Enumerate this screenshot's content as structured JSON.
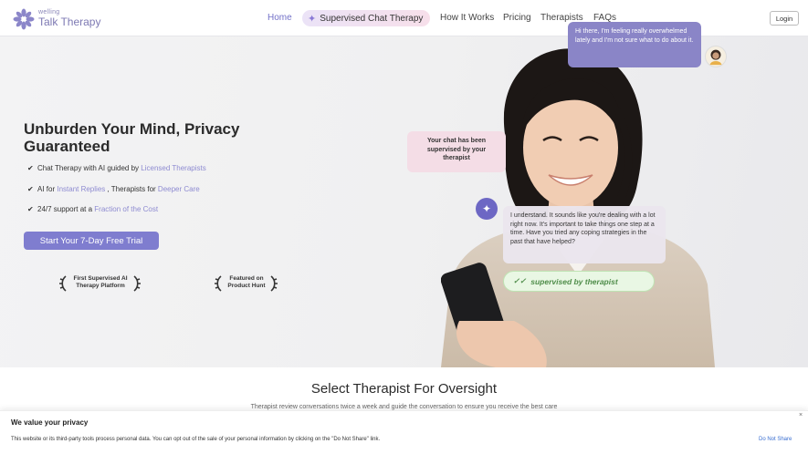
{
  "brand": {
    "tagline": "welling",
    "name": "Talk Therapy"
  },
  "nav": {
    "home": "Home",
    "supervised": "Supervised Chat Therapy",
    "how": "How It Works",
    "pricing": "Pricing",
    "therapists": "Therapists",
    "faqs": "FAQs",
    "login": "Login"
  },
  "hero": {
    "title": "Unburden Your Mind, Privacy Guaranteed",
    "bullets": [
      {
        "pre": "Chat Therapy with AI guided by ",
        "hl1": "Licensed Therapists",
        "mid": "",
        "hl2": ""
      },
      {
        "pre": "AI for ",
        "hl1": "Instant Replies",
        "mid": " , Therapists for ",
        "hl2": "Deeper Care"
      },
      {
        "pre": "24/7 support at a ",
        "hl1": "Fraction of the Cost",
        "mid": "",
        "hl2": ""
      }
    ],
    "cta": "Start Your 7-Day Free Trial",
    "awards": [
      {
        "line1": "First Supervised AI",
        "line2": "Therapy Platform"
      },
      {
        "line1": "Featured on",
        "line2": "Product Hunt"
      }
    ]
  },
  "chat": {
    "user_message": "Hi there, I'm feeling really overwhelmed lately and I'm not sure what to do about it.",
    "supervised_note": "Your chat has been supervised by your therapist",
    "ai_reply": "I understand. It sounds like you're dealing with a lot right now. It's important to take things one step at a time. Have you tried any coping strategies in the past that have helped?",
    "badge": "supervised by therapist"
  },
  "section": {
    "title": "Select Therapist For Oversight",
    "subtitle": "Therapist review conversations twice a week and guide the conversation to ensure you receive the best care"
  },
  "cookie": {
    "title": "We value your privacy",
    "text": "This website or its third-party tools process personal data. You can opt out of the sale of your personal information by clicking on the \"Do Not Share\" link.",
    "link": "Do Not Share",
    "close": "×"
  },
  "colors": {
    "accent": "#7f7dcf",
    "nav_active": "#7472c9",
    "supervised_green": "#4f8d4a"
  }
}
